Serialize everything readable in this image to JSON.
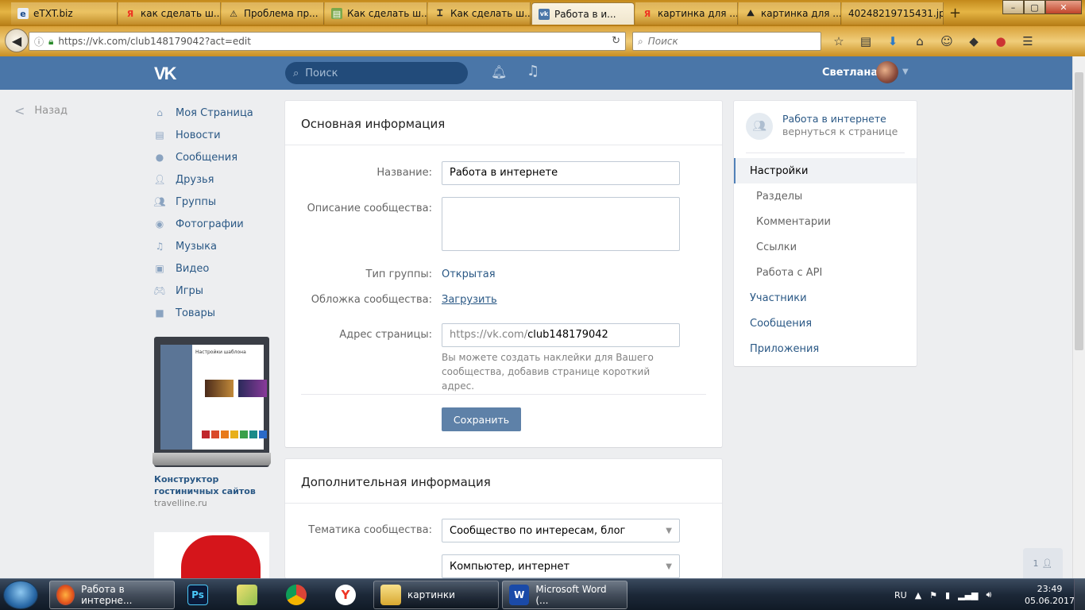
{
  "browser": {
    "tabs": [
      {
        "label": "eTXT.biz",
        "icon": "etxt-icon"
      },
      {
        "label": "как сделать ш...",
        "icon": "yandex-icon"
      },
      {
        "label": "Проблема пр...",
        "icon": "warning-icon"
      },
      {
        "label": "Как сделать ш...",
        "icon": "page-icon"
      },
      {
        "label": "Как сделать ш...",
        "icon": "page-icon"
      },
      {
        "label": "Работа в и...",
        "icon": "vk-icon"
      },
      {
        "label": "картинка для ...",
        "icon": "yandex-icon"
      },
      {
        "label": "картинка для ...",
        "icon": "image-icon"
      },
      {
        "label": "40248219715431.jp...",
        "icon": "image-icon"
      }
    ],
    "url": "https://vk.com/club148179042?act=edit",
    "search_placeholder": "Поиск"
  },
  "vk_header": {
    "logo": "VK",
    "search_placeholder": "Поиск",
    "user_name": "Светлана"
  },
  "left_nav": {
    "back_label": "Назад",
    "items": [
      {
        "label": "Моя Страница",
        "icon": "home-icon"
      },
      {
        "label": "Новости",
        "icon": "news-icon"
      },
      {
        "label": "Сообщения",
        "icon": "messages-icon"
      },
      {
        "label": "Друзья",
        "icon": "friends-icon"
      },
      {
        "label": "Группы",
        "icon": "groups-icon"
      },
      {
        "label": "Фотографии",
        "icon": "camera-icon"
      },
      {
        "label": "Музыка",
        "icon": "music-icon"
      },
      {
        "label": "Видео",
        "icon": "video-icon"
      },
      {
        "label": "Игры",
        "icon": "games-icon"
      },
      {
        "label": "Товары",
        "icon": "bag-icon"
      }
    ],
    "ad": {
      "mock_title": "Настройки шаблона",
      "title": "Конструктор гостиничных сайтов",
      "site": "travelline.ru"
    }
  },
  "main": {
    "basic": {
      "heading": "Основная информация",
      "name_label": "Название:",
      "name_value": "Работа в интернете",
      "description_label": "Описание сообщества:",
      "description_value": "",
      "group_type_label": "Тип группы:",
      "group_type_value": "Открытая",
      "cover_label": "Обложка сообщества:",
      "cover_value": "Загрузить",
      "address_label": "Адрес страницы:",
      "address_prefix": "https://vk.com/",
      "address_value": "club148179042",
      "address_hint": "Вы можете создать наклейки для Вашего сообщества, добавив странице короткий адрес.",
      "save_label": "Сохранить"
    },
    "extra": {
      "heading": "Дополнительная информация",
      "topic_label": "Тематика сообщества:",
      "topic_value": "Сообщество по интересам, блог",
      "subtopic_value": "Компьютер, интернет"
    }
  },
  "right_menu": {
    "group_name": "Работа в интернете",
    "group_back": "вернуться к странице",
    "items": [
      {
        "label": "Настройки",
        "type": "active"
      },
      {
        "label": "Разделы",
        "type": "sub"
      },
      {
        "label": "Комментарии",
        "type": "sub"
      },
      {
        "label": "Ссылки",
        "type": "sub"
      },
      {
        "label": "Работа с API",
        "type": "sub"
      },
      {
        "label": "Участники",
        "type": "top"
      },
      {
        "label": "Сообщения",
        "type": "top"
      },
      {
        "label": "Приложения",
        "type": "top"
      }
    ]
  },
  "friends_counter": "1",
  "taskbar": {
    "items": [
      {
        "label": "Работа в интерне...",
        "icon": "firefox-icon"
      },
      {
        "label": "",
        "icon": "photoshop-icon"
      },
      {
        "label": "",
        "icon": "folder-note-icon"
      },
      {
        "label": "",
        "icon": "chrome-icon"
      },
      {
        "label": "",
        "icon": "yandex-browser-icon"
      },
      {
        "label": "картинки",
        "icon": "folder-icon"
      },
      {
        "label": "Microsoft Word (...",
        "icon": "word-icon"
      }
    ],
    "language": "RU",
    "time": "23:49",
    "date": "05.06.2017"
  }
}
